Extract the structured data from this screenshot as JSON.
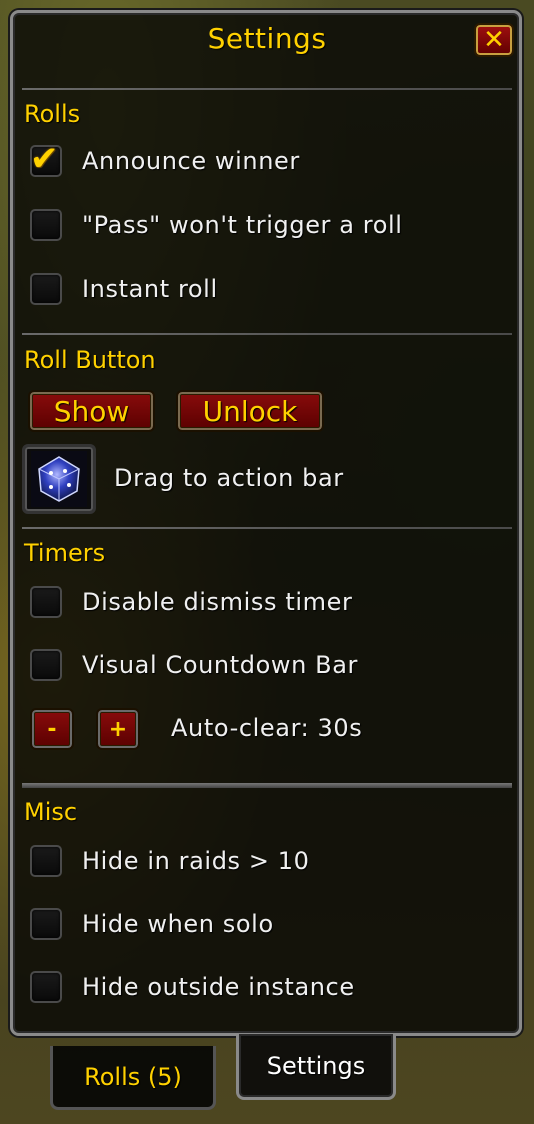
{
  "window": {
    "title": "Settings",
    "close_label": "✕"
  },
  "sections": {
    "rolls": {
      "title": "Rolls",
      "options": [
        {
          "label": "Announce winner",
          "checked": true
        },
        {
          "label": "\"Pass\" won't trigger a roll",
          "checked": false
        },
        {
          "label": "Instant roll",
          "checked": false
        }
      ]
    },
    "roll_button": {
      "title": "Roll Button",
      "show_label": "Show",
      "unlock_label": "Unlock",
      "drag_label": "Drag to action bar",
      "icon": "dice-icon"
    },
    "timers": {
      "title": "Timers",
      "options": [
        {
          "label": "Disable dismiss timer",
          "checked": false
        },
        {
          "label": "Visual Countdown Bar",
          "checked": false
        }
      ],
      "minus_label": "-",
      "plus_label": "+",
      "auto_clear_label": "Auto-clear: 30s"
    },
    "misc": {
      "title": "Misc",
      "options": [
        {
          "label": "Hide in raids > 10",
          "checked": false
        },
        {
          "label": "Hide when solo",
          "checked": false
        },
        {
          "label": "Hide outside instance",
          "checked": false
        }
      ]
    }
  },
  "tabs": [
    {
      "label": "Rolls (5)",
      "active": false
    },
    {
      "label": "Settings",
      "active": true
    }
  ],
  "colors": {
    "gold": "#ffd100",
    "button_red": "#7a0808",
    "text": "#f0f0f0"
  }
}
